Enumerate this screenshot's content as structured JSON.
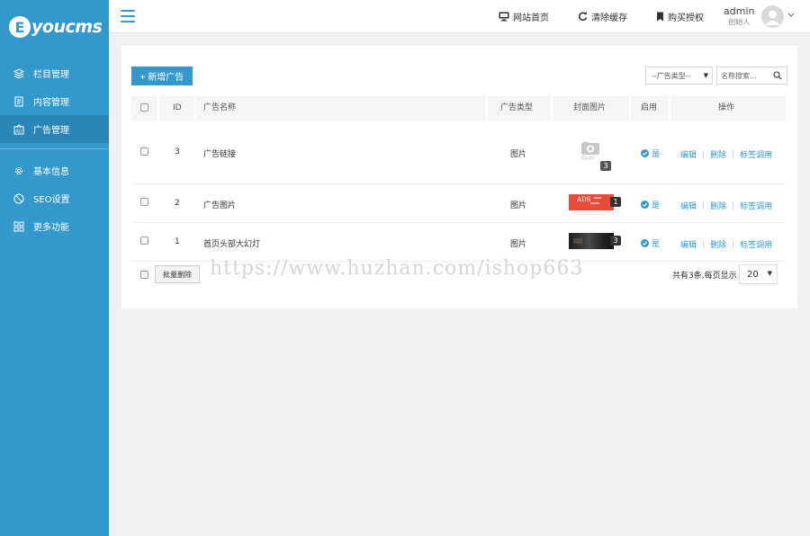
{
  "logo": {
    "letter": "E",
    "text": "youcms"
  },
  "sidebar": {
    "items": [
      {
        "label": "栏目管理",
        "icon": "layers-icon"
      },
      {
        "label": "内容管理",
        "icon": "document-icon"
      },
      {
        "label": "广告管理",
        "icon": "ad-icon",
        "active": true
      },
      {
        "label": "基本信息",
        "icon": "gear-icon"
      },
      {
        "label": "SEO设置",
        "icon": "seo-icon"
      },
      {
        "label": "更多功能",
        "icon": "grid-icon"
      }
    ]
  },
  "header": {
    "site_home": "网站首页",
    "clear_cache": "清除缓存",
    "buy_license": "购买授权",
    "user_name": "admin",
    "user_role": "创始人"
  },
  "toolbar": {
    "add_button": "+ 新增广告",
    "type_select": "--广告类型--",
    "search_placeholder": "名称搜索..."
  },
  "table": {
    "columns": {
      "id": "ID",
      "name": "广告名称",
      "type": "广告类型",
      "cover": "封面图片",
      "enabled": "启用",
      "actions": "操作"
    },
    "rows": [
      {
        "id": "3",
        "name": "广告链接",
        "type": "图片",
        "cover_count": "3",
        "cover_caption": "暂无图片",
        "enabled": "是",
        "edit": "编辑",
        "delete": "删除",
        "tag": "标签调用"
      },
      {
        "id": "2",
        "name": "广告图片",
        "type": "图片",
        "cover_count": "1",
        "cover_caption": "ADS",
        "enabled": "是",
        "edit": "编辑",
        "delete": "删除",
        "tag": "标签调用"
      },
      {
        "id": "1",
        "name": "首页头部大幻灯",
        "type": "图片",
        "cover_count": "3",
        "enabled": "是",
        "edit": "编辑",
        "delete": "删除",
        "tag": "标签调用"
      }
    ]
  },
  "footer": {
    "batch_delete": "批量删除",
    "total_text": "共有3条,每页显示",
    "page_size": "20"
  },
  "watermark": "https://www.huzhan.com/ishop663",
  "colors": {
    "accent": "#3398cc",
    "sidebar_active": "#2a86b8"
  }
}
